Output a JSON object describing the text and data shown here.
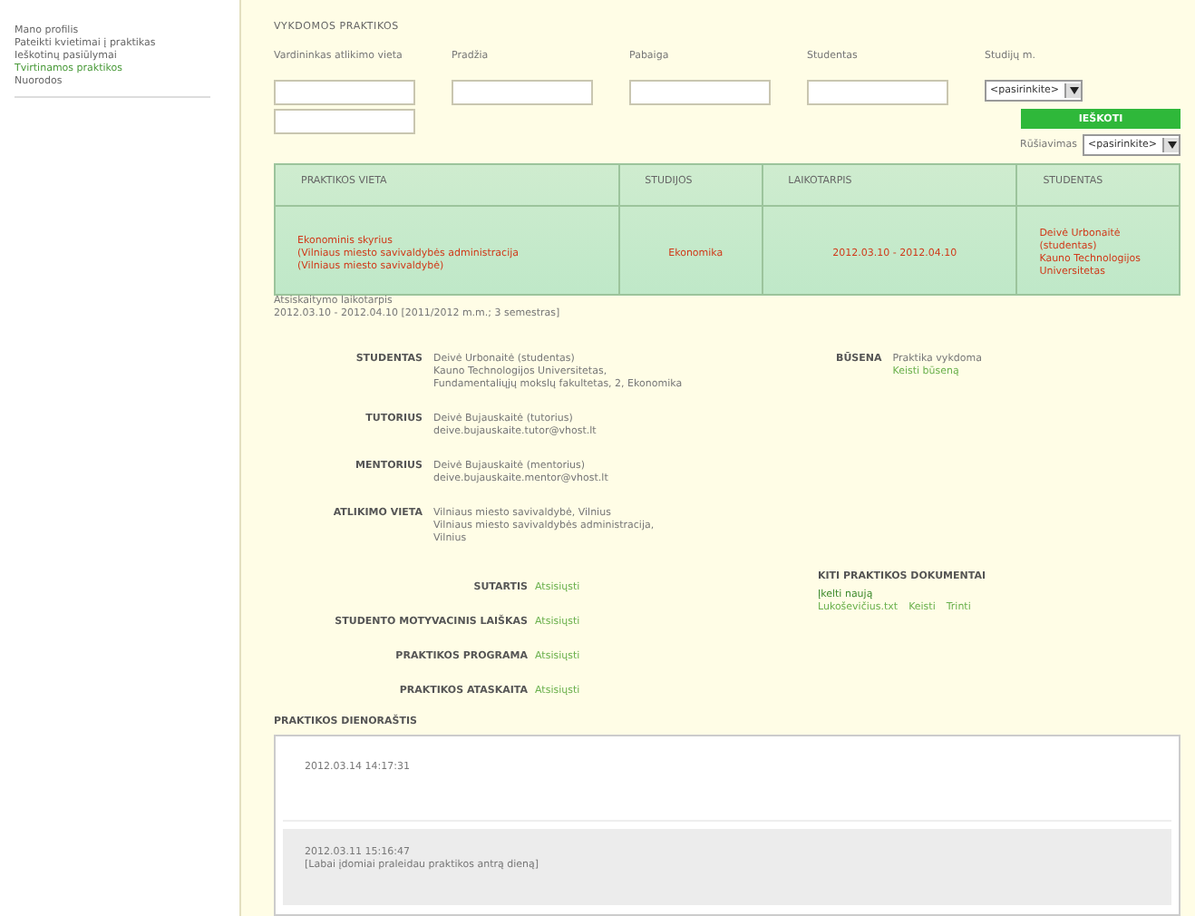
{
  "sidebar": {
    "items": [
      {
        "label": "Mano profilis",
        "selected": false
      },
      {
        "label": "Pateikti kvietimai į praktikas",
        "selected": false
      },
      {
        "label": "Ieškotinų pasiūlymai",
        "selected": false
      },
      {
        "label": "Tvirtinamos praktikos",
        "selected": true
      },
      {
        "label": "Nuorodos",
        "selected": false
      }
    ]
  },
  "page": {
    "title": "VYKDOMOS PRAKTIKOS"
  },
  "filters": {
    "fields": [
      {
        "label": "Vardininkas atlikimo vieta",
        "kind": "double"
      },
      {
        "label": "Pradžia",
        "kind": "text"
      },
      {
        "label": "Pabaiga",
        "kind": "text"
      },
      {
        "label": "Studentas",
        "kind": "text"
      }
    ],
    "year": {
      "label": "Studijų m.",
      "value": "<pasirinkite>"
    },
    "search_button": "IEŠKOTI",
    "sort": {
      "label": "Rūšiavimas",
      "value": "<pasirinkite>"
    }
  },
  "table": {
    "columns": [
      "PRAKTIKOS VIETA",
      "STUDIJOS",
      "LAIKOTARPIS",
      "STUDENTAS"
    ],
    "rows": [
      {
        "cells": [
          [
            "Ekonominis skyrius",
            "(Vilniaus miesto savivaldybės administracija",
            "(Vilniaus miesto savivaldybė)"
          ],
          [
            "Ekonomika"
          ],
          [
            "2012.03.10 - 2012.04.10"
          ],
          [
            "Deivė Urbonaitė",
            "(studentas)",
            "Kauno Technologijos",
            "Universitetas"
          ]
        ]
      }
    ]
  },
  "period": {
    "label": "Atsiskaitymo laikotarpis",
    "value": "2012.03.10 - 2012.04.10 [2011/2012 m.m.; 3 semestras]"
  },
  "details": [
    {
      "label": "STUDENTAS",
      "lines": [
        "Deivė Urbonaitė (studentas)",
        "Kauno Technologijos Universitetas,",
        "Fundamentaliųjų mokslų fakultetas, 2, Ekonomika"
      ]
    },
    {
      "label": "TUTORIUS",
      "lines": [
        "Deivė Bujauskaitė (tutorius)",
        "deive.bujauskaite.tutor@vhost.lt"
      ]
    },
    {
      "label": "MENTORIUS",
      "lines": [
        "Deivė Bujauskaitė (mentorius)",
        "deive.bujauskaite.mentor@vhost.lt"
      ]
    },
    {
      "label": "ATLIKIMO VIETA",
      "lines": [
        "Vilniaus miesto savivaldybė, Vilnius",
        "Vilniaus miesto savivaldybės administracija,",
        "Vilnius"
      ]
    }
  ],
  "status": {
    "label": "BŪSENA",
    "value": "Praktika vykdoma",
    "link": "Keisti būseną"
  },
  "documents": [
    {
      "label": "SUTARTIS",
      "link": "Atsisiųsti"
    },
    {
      "label": "STUDENTO MOTYVACINIS LAIŠKAS",
      "link": "Atsisiųsti"
    },
    {
      "label": "PRAKTIKOS PROGRAMA",
      "link": "Atsisiųsti"
    },
    {
      "label": "PRAKTIKOS ATASKAITA",
      "link": "Atsisiųsti"
    }
  ],
  "other_documents": {
    "title": "KITI PRAKTIKOS DOKUMENTAI",
    "upload": "Įkelti naują",
    "files": [
      "Lukoševičius.txt",
      "Keisti",
      "Trinti"
    ]
  },
  "diary": {
    "title": "PRAKTIKOS DIENORAŠTIS",
    "entries": [
      {
        "date": "2012.03.14 14:17:31",
        "selected": false
      },
      {
        "date": "2012.03.11 15:16:47",
        "text": "[Labai įdomiai praleidau praktikos antrą dieną]",
        "selected": true
      }
    ]
  }
}
